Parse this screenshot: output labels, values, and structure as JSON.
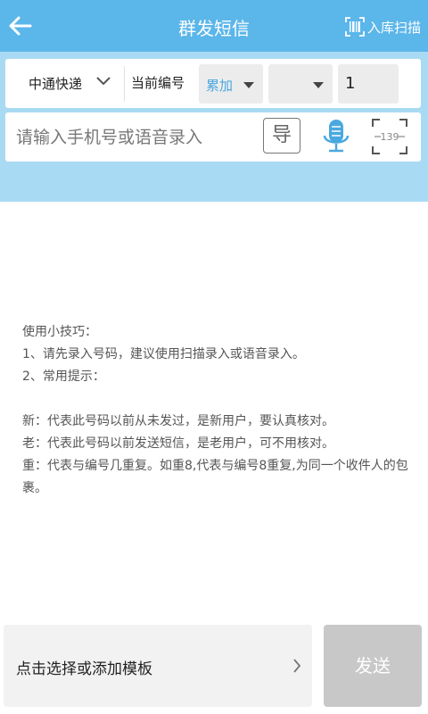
{
  "header": {
    "title": "群发短信",
    "scan_label": "入库扫描",
    "back_icon": "back-arrow-icon",
    "scan_icon": "barcode-scan-icon"
  },
  "toolbar": {
    "courier": "中通快递",
    "current_number_label": "当前编号",
    "mode": "累加",
    "blank_select": "",
    "number_value": "1"
  },
  "input": {
    "placeholder": "请输入手机号或语音录入",
    "import_label": "导",
    "ocr_label": "139"
  },
  "tips": {
    "title": "使用小技巧：",
    "line1": "1、请先录入号码，建议使用扫描录入或语音录入。",
    "line2": "2、常用提示：",
    "new": "新：代表此号码以前从未发过，是新用户，要认真核对。",
    "old": "老：代表此号码以前发送短信，是老用户，可不用核对。",
    "repeat": "重：代表与编号几重复。如重8,代表与编号8重复,为同一个收件人的包裹。"
  },
  "footer": {
    "template_label": "点击选择或添加模板",
    "send_label": "发送"
  },
  "colors": {
    "header": "#5bb6ea",
    "input_area": "#a9daf3",
    "accent": "#4aa8e0",
    "send_disabled": "#c8c8c8"
  }
}
